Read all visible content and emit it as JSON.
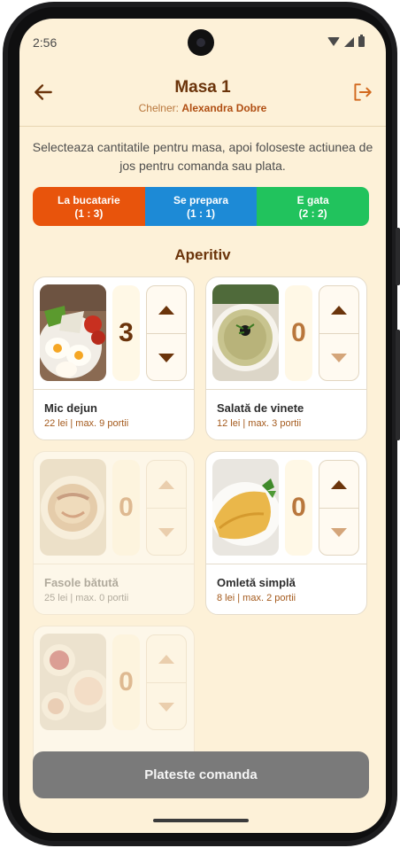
{
  "status_bar": {
    "time": "2:56"
  },
  "header": {
    "title": "Masa 1",
    "waiter_label": "Chelner:",
    "waiter_name": "Alexandra Dobre"
  },
  "instructions": "Selecteaza cantitatile pentru masa, apoi foloseste actiunea de jos pentru comanda sau plata.",
  "legend": [
    {
      "label": "La bucatarie",
      "count": "(1 : 3)",
      "color": "#e8540c"
    },
    {
      "label": "Se prepara",
      "count": "(1 : 1)",
      "color": "#1d8ad6"
    },
    {
      "label": "E gata",
      "count": "(2 : 2)",
      "color": "#21c35d"
    }
  ],
  "section": {
    "title": "Aperitiv"
  },
  "items": [
    {
      "name": "Mic dejun",
      "price": "22 lei",
      "max": "max. 9 portii",
      "qty": "3",
      "image": "breakfast-eggs",
      "disabled": false
    },
    {
      "name": "Salată de vinete",
      "price": "12 lei",
      "max": "max. 3 portii",
      "qty": "0",
      "image": "eggplant-salad",
      "disabled": false
    },
    {
      "name": "Fasole bătută",
      "price": "25 lei",
      "max": "max. 0 portii",
      "qty": "0",
      "image": "bean-dip",
      "disabled": true
    },
    {
      "name": "Omletă simplă",
      "price": "8 lei",
      "max": "max. 2 portii",
      "qty": "0",
      "image": "omelette",
      "disabled": false
    },
    {
      "name": "",
      "price": "",
      "max": "",
      "qty": "0",
      "image": "salad-bowls",
      "disabled": true
    }
  ],
  "footer": {
    "pay_button": "Plateste comanda"
  },
  "colors": {
    "background": "#fdf1d8",
    "brand_brown": "#6b340b",
    "button_gray": "#7a7a7a"
  }
}
